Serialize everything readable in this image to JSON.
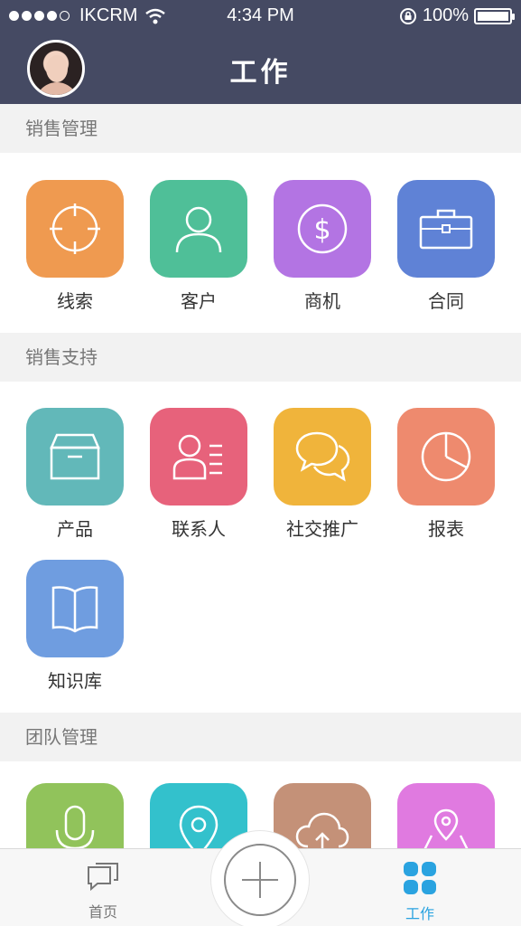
{
  "status_bar": {
    "carrier": "IKCRM",
    "time": "4:34 PM",
    "battery_percent": "100%"
  },
  "header": {
    "title": "工作"
  },
  "sections": [
    {
      "title": "销售管理",
      "tiles": [
        {
          "label": "线索",
          "icon": "target-icon",
          "color": "#ef9a50"
        },
        {
          "label": "客户",
          "icon": "person-icon",
          "color": "#4fbf98"
        },
        {
          "label": "商机",
          "icon": "dollar-icon",
          "color": "#b374e3"
        },
        {
          "label": "合同",
          "icon": "briefcase-icon",
          "color": "#5f82d6"
        }
      ]
    },
    {
      "title": "销售支持",
      "tiles": [
        {
          "label": "产品",
          "icon": "box-icon",
          "color": "#62b8b9"
        },
        {
          "label": "联系人",
          "icon": "contact-card-icon",
          "color": "#e7627b"
        },
        {
          "label": "社交推广",
          "icon": "chat-bubbles-icon",
          "color": "#f0b43b"
        },
        {
          "label": "报表",
          "icon": "pie-chart-icon",
          "color": "#ee8a6e"
        },
        {
          "label": "知识库",
          "icon": "book-icon",
          "color": "#6f9de0"
        }
      ]
    },
    {
      "title": "团队管理",
      "tiles": [
        {
          "label": "",
          "icon": "microphone-icon",
          "color": "#91c35b"
        },
        {
          "label": "",
          "icon": "location-pin-icon",
          "color": "#33c1cc"
        },
        {
          "label": "",
          "icon": "cloud-upload-icon",
          "color": "#c49178"
        },
        {
          "label": "",
          "icon": "map-pin-icon",
          "color": "#e07ae0"
        }
      ]
    }
  ],
  "tabbar": {
    "home_label": "首页",
    "work_label": "工作",
    "active_color": "#2aa3e0",
    "inactive_color": "#777777"
  }
}
